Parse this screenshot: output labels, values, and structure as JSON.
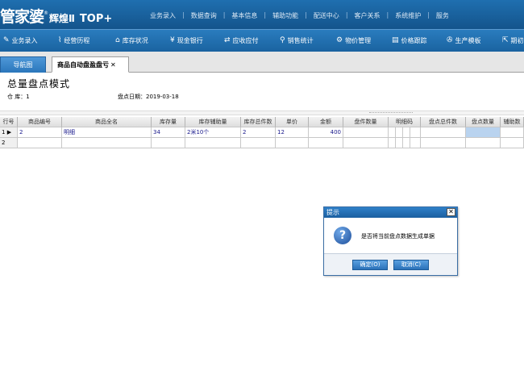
{
  "app": {
    "logo_main": "管家婆",
    "logo_reg": "®",
    "logo_sub": "辉煌Ⅱ",
    "logo_top": "TOP+"
  },
  "top_nav": [
    "业务录入",
    "数据查询",
    "基本信息",
    "辅助功能",
    "配送中心",
    "客户关系",
    "系统维护",
    "服务"
  ],
  "toolbar": [
    {
      "icon": "pen-icon",
      "glyph": "✎",
      "label": "业务录入"
    },
    {
      "icon": "chart-icon",
      "glyph": "⌇",
      "label": "经营历程"
    },
    {
      "icon": "house-icon",
      "glyph": "⌂",
      "label": "库存状况"
    },
    {
      "icon": "yen-icon",
      "glyph": "¥",
      "label": "现金银行"
    },
    {
      "icon": "arrows-icon",
      "glyph": "⇄",
      "label": "应收应付"
    },
    {
      "icon": "search-icon",
      "glyph": "⚲",
      "label": "销售统计"
    },
    {
      "icon": "gear-icon",
      "glyph": "⚙",
      "label": "物价管理"
    },
    {
      "icon": "book-icon",
      "glyph": "▤",
      "label": "价格跟踪"
    },
    {
      "icon": "wrench-icon",
      "glyph": "✇",
      "label": "生产模板"
    },
    {
      "icon": "export-icon",
      "glyph": "⇱",
      "label": "期初"
    }
  ],
  "tabs": {
    "nav_label": "导航图",
    "active_label": "商品自动盘盈盘亏",
    "close_glyph": "✕"
  },
  "page": {
    "title": "总量盘点模式",
    "warehouse_label": "仓    库：",
    "warehouse_value": "1",
    "date_label": "盘点日期：",
    "date_value": "2019-03-18"
  },
  "grid": {
    "columns": [
      "行号",
      "商品编号",
      "商品全名",
      "库存量",
      "库存辅助量",
      "库存总件数",
      "单价",
      "金额",
      "盘件数量",
      "明细码",
      "",
      "",
      "",
      "盘点总件数",
      "盘点数量",
      "辅助数"
    ],
    "rows": [
      {
        "row": "1",
        "marker": "▶",
        "code": "2",
        "name": "明细",
        "stock": "34",
        "aux": "2米10个",
        "total": "2",
        "price": "12",
        "amount": "400",
        "pieces": "",
        "detail": "",
        "count_total": "",
        "count_qty": "",
        "aux_count": ""
      },
      {
        "row": "2",
        "marker": "",
        "code": "",
        "name": "",
        "stock": "",
        "aux": "",
        "total": "",
        "price": "",
        "amount": "",
        "pieces": "",
        "detail": "",
        "count_total": "",
        "count_qty": "",
        "aux_count": ""
      }
    ]
  },
  "dialog": {
    "title": "提示",
    "close_glyph": "✕",
    "icon_glyph": "?",
    "message": "是否将当前盘点数据生成单据",
    "ok_label": "确定(O)",
    "cancel_label": "取消(C)"
  }
}
